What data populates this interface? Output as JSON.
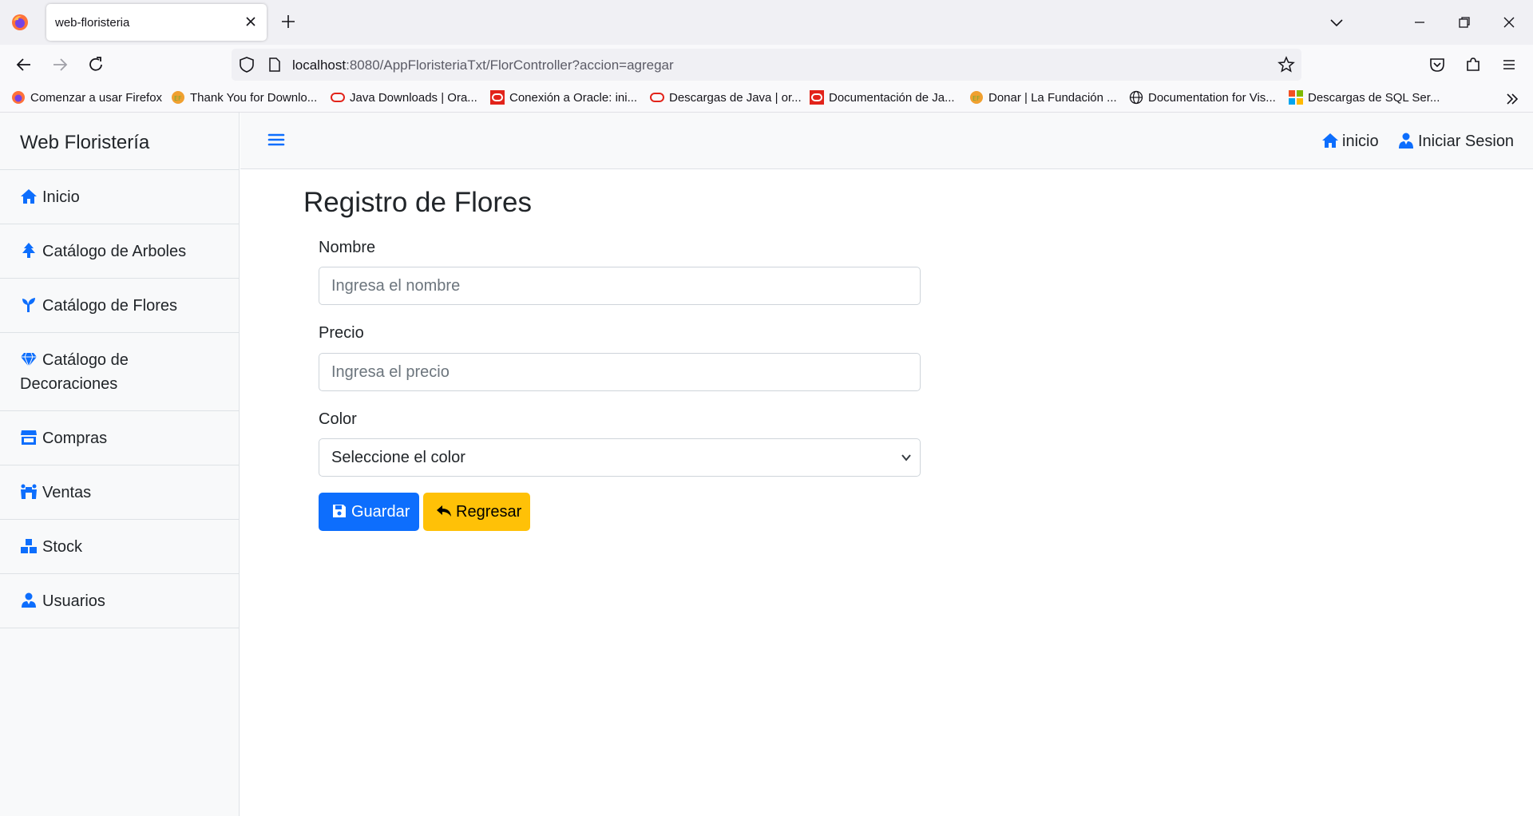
{
  "browser": {
    "tab_title": "web-floristeria",
    "url_host": "localhost",
    "url_rest": ":8080/AppFloristeriaTxt/FlorController?accion=agregar",
    "bookmarks": [
      "Comenzar a usar Firefox",
      "Thank You for Downlo...",
      "Java Downloads | Ora...",
      "Conexión a Oracle: ini...",
      "Descargas de Java | or...",
      "Documentación de Ja...",
      "Donar | La Fundación ...",
      "Documentation for Vis...",
      "Descargas de SQL Ser..."
    ]
  },
  "sidebar": {
    "brand": "Web Floristería",
    "items": [
      {
        "label": "Inicio",
        "icon": "home-icon"
      },
      {
        "label": "Catálogo de Arboles",
        "icon": "tree-icon"
      },
      {
        "label": "Catálogo de Flores",
        "icon": "seedling-icon"
      },
      {
        "label": "Catálogo de Decoraciones",
        "icon": "gem-icon"
      },
      {
        "label": "Compras",
        "icon": "store-icon"
      },
      {
        "label": "Ventas",
        "icon": "people-carry-icon"
      },
      {
        "label": "Stock",
        "icon": "cubes-icon"
      },
      {
        "label": "Usuarios",
        "icon": "user-tie-icon"
      }
    ]
  },
  "topnav": {
    "home_label": "inicio",
    "login_label": "Iniciar Sesion"
  },
  "form": {
    "title": "Registro de Flores",
    "nombre_label": "Nombre",
    "nombre_placeholder": "Ingresa el nombre",
    "precio_label": "Precio",
    "precio_placeholder": "Ingresa el precio",
    "color_label": "Color",
    "color_selected": "Seleccione el color",
    "save_label": "Guardar",
    "back_label": "Regresar"
  },
  "colors": {
    "primary": "#0d6efd",
    "warning": "#ffc107",
    "sidebar_bg": "#f8f9fa"
  }
}
